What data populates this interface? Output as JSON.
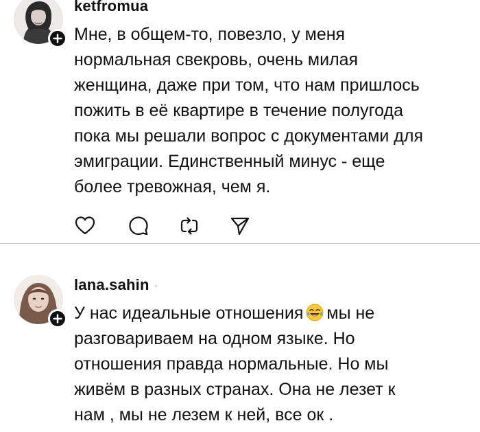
{
  "posts": [
    {
      "username": "ketfromua",
      "avatar": "woman-dark-hair-avatar",
      "badge_icon": "plus-icon",
      "lines": [
        "Мне, в общем-то, повезло, у меня",
        "нормальная свекровь, очень милая",
        "женщина, даже при том, что нам пришлось",
        "пожить в её квартире в течение полугода",
        "пока мы решали вопрос с документами для",
        "эмиграции. Единственный минус - еще",
        "более тревожная, чем я."
      ],
      "actions": [
        "heart-icon",
        "comment-icon",
        "repost-icon",
        "share-icon"
      ]
    },
    {
      "username": "lana.sahin",
      "avatar": "woman-light-hair-avatar",
      "badge_icon": "plus-icon",
      "line1_before_emoji": "У нас идеальные отношения",
      "emoji": "face-with-tears-of-joy-emoji",
      "line1_after_emoji": "мы не",
      "lines_rest": [
        "разговариваем на одном языке. Но",
        "отношения правда нормальные. Но мы",
        "живём в разных странах. Она не лезет к",
        "нам , мы не лезем к ней, все ок ."
      ]
    }
  ],
  "colors": {
    "text": "#111111",
    "divider": "#cfcfcf",
    "badge": "#111111",
    "background": "#ffffff"
  }
}
